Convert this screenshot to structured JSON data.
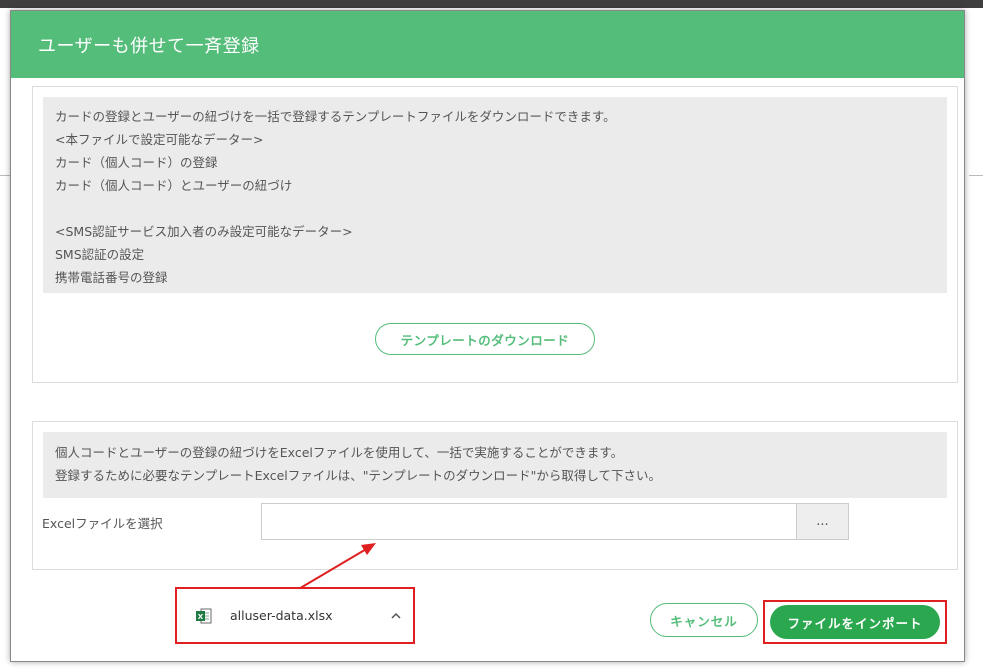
{
  "modal": {
    "title": "ユーザーも併せて一斉登録"
  },
  "template_section": {
    "lines": [
      "カードの登録とユーザーの紐づけを一括で登録するテンプレートファイルをダウンロードできます。",
      "<本ファイルで設定可能なデーター>",
      "カード（個人コード）の登録",
      "カード（個人コード）とユーザーの紐づけ",
      "",
      "<SMS認証サービス加入者のみ設定可能なデーター>",
      "SMS認証の設定",
      "携帯電話番号の登録"
    ],
    "download_button": "テンプレートのダウンロード"
  },
  "import_section": {
    "lines": [
      "個人コードとユーザーの登録の紐づけをExcelファイルを使用して、一括で実施することができます。",
      "登録するために必要なテンプレートExcelファイルは、\"テンプレートのダウンロード\"から取得して下さい。"
    ],
    "file_label": "Excelファイルを選択",
    "file_value": "",
    "browse_label": "..."
  },
  "download_bar": {
    "file_name": "alluser-data.xlsx",
    "file_icon": "excel-file-icon",
    "expand_icon": "chevron-up-icon"
  },
  "footer": {
    "cancel_label": "キャンセル",
    "import_label": "ファイルをインポート"
  },
  "colors": {
    "header": "#55bd7a",
    "primary_button": "#2ba84f",
    "highlight": "#e02020",
    "info_bg": "#ebebeb"
  }
}
